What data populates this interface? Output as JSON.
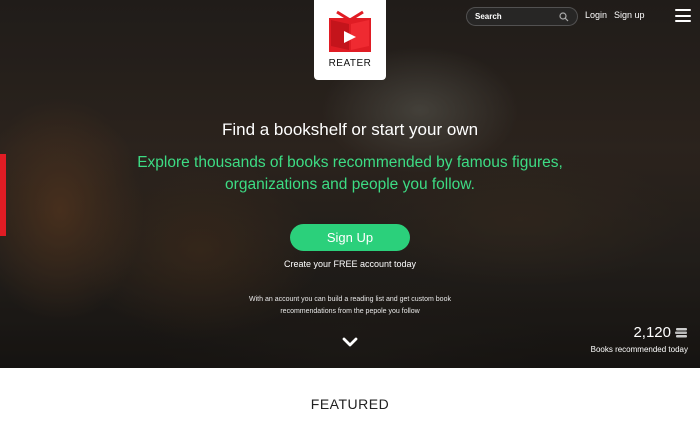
{
  "brand": {
    "name": "REATER",
    "logo_color": "#e01c24"
  },
  "header": {
    "search_label": "Search",
    "search_icon": "search-icon",
    "login_label": "Login",
    "signup_label": "Sign up",
    "menu_icon": "hamburger-menu-icon"
  },
  "hero": {
    "headline": "Find a bookshelf or start your own",
    "subheadline": "Explore thousands of books recommended by famous figures, organizations and people you follow.",
    "cta_label": "Sign Up",
    "cta_sub": "Create your FREE account today",
    "account_note": "With an account you can build a reading list and get custom book recommendations from the pepole you follow",
    "scroll_icon": "chevron-down-icon",
    "books_count": "2,120",
    "books_count_icon": "books-stack-icon",
    "books_count_label": "Books recommended today",
    "accent_color": "#3ddc84",
    "button_color": "#2bd07b"
  },
  "section": {
    "title": "FEATURED"
  }
}
